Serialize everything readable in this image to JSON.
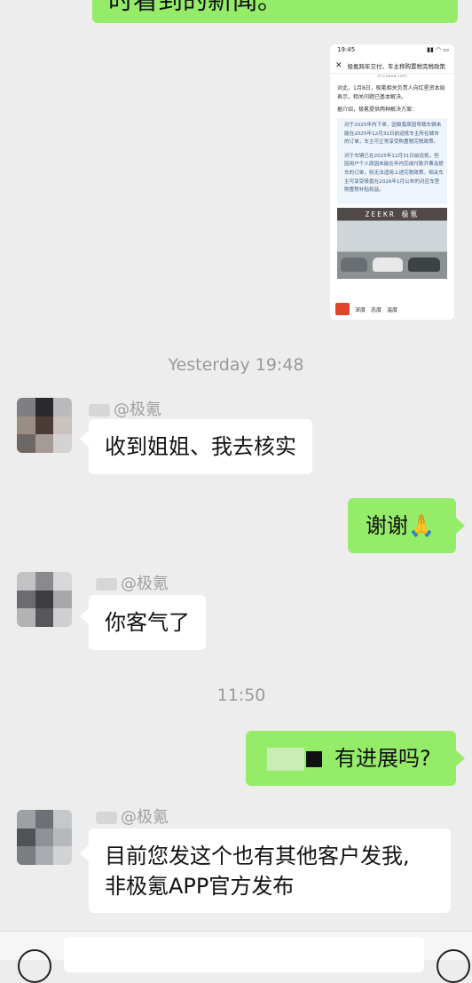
{
  "top_message": {
    "text": "时看到的新闻。"
  },
  "shared_card": {
    "status_time": "19:45",
    "status_icons": "▮▮ ◠ ▭",
    "nav_title": "极氪跨年交付，车主称购置税完税政策",
    "url": "m.cxaoa.com",
    "para1": "对此，1月8日，极氪相关负责人向红星资本局表示，相关问题已基本解决。",
    "para2": "据介绍，极氪提供两种解决方案：",
    "quote1": "对于2025年内下单、因极氪原因导致车辆未能在2025年12月31日前运抵车主所在城市的订单，车主可正常享受购置税完税政策。",
    "quote2": "对于车辆已在2025年12月31日前运抵，但因用户个人原因未能在年内完成付款开票及提车的订单，则无法适用上述完税政策。相关车主可享受极氪在2026年1月公布的对应车型购置税补贴权益。",
    "photo_brand": "ZEEKR 极氪",
    "footer_items": [
      "深度",
      "态度",
      "温度"
    ]
  },
  "timestamps": [
    "Yesterday 19:48",
    "11:50"
  ],
  "messages": [
    {
      "sender": "@极氪",
      "text": "收到姐姐、我去核实"
    },
    {
      "text": "谢谢🙏"
    },
    {
      "sender": "@极氪",
      "text": "你客气了"
    },
    {
      "text": "有进展吗?"
    },
    {
      "sender": "@极氪",
      "line1": "目前您发这个也有其他客户发我,",
      "line2": "非极氪APP官方发布"
    }
  ],
  "colors": {
    "background": "#ededed",
    "outgoing": "#95ec69",
    "incoming": "#ffffff"
  }
}
